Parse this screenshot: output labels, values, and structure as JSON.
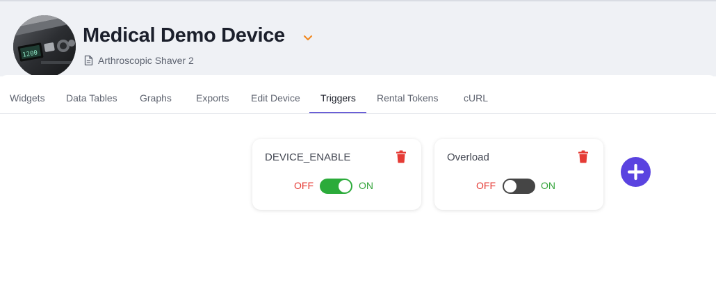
{
  "device": {
    "title": "Medical Demo Device",
    "subtitle": "Arthroscopic Shaver 2",
    "avatar_display_value": "1200"
  },
  "tabs": [
    {
      "label": "Widgets"
    },
    {
      "label": "Data Tables"
    },
    {
      "label": "Graphs"
    },
    {
      "label": "Exports"
    },
    {
      "label": "Edit Device"
    },
    {
      "label": "Triggers",
      "active": true
    },
    {
      "label": "Rental Tokens"
    },
    {
      "label": "cURL"
    }
  ],
  "triggers": [
    {
      "name": "DEVICE_ENABLE",
      "off_label": "OFF",
      "on_label": "ON",
      "enabled": true
    },
    {
      "name": "Overload",
      "off_label": "OFF",
      "on_label": "ON",
      "enabled": false
    }
  ],
  "colors": {
    "accent": "#5a43e0",
    "tab_underline": "#6a5fd6",
    "off_text": "#e53b35",
    "on_text": "#34a43b",
    "switch_on": "#2bab3a",
    "switch_off": "#454545",
    "trash": "#e53b35",
    "chevron": "#f08a24"
  },
  "icons": {
    "title_dropdown": "chevron-down-icon",
    "subtitle": "document-icon",
    "delete": "trash-icon",
    "add": "plus-icon"
  }
}
